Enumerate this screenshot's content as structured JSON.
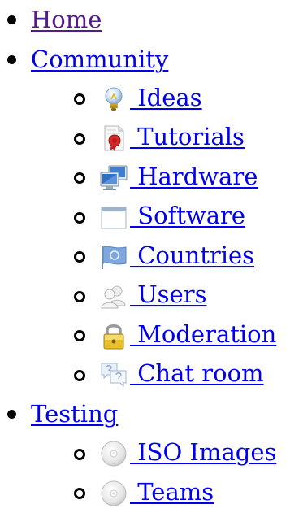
{
  "nav": {
    "items": [
      {
        "label": "Home"
      },
      {
        "label": "Community"
      },
      {
        "label": "Testing"
      }
    ],
    "community_children": [
      {
        "label": " Ideas",
        "icon": "lightbulb-icon"
      },
      {
        "label": " Tutorials",
        "icon": "document-seal-icon"
      },
      {
        "label": " Hardware",
        "icon": "computers-icon"
      },
      {
        "label": " Software",
        "icon": "window-icon"
      },
      {
        "label": " Countries",
        "icon": "flag-icon"
      },
      {
        "label": " Users",
        "icon": "users-icon"
      },
      {
        "label": " Moderation",
        "icon": "padlock-icon"
      },
      {
        "label": " Chat room",
        "icon": "speech-bubbles-icon"
      }
    ],
    "testing_children": [
      {
        "label": " ISO Images",
        "icon": "disc-icon"
      },
      {
        "label": " Teams",
        "icon": "disc-icon"
      }
    ]
  },
  "colors": {
    "link": "#0000ee",
    "visited_link": "#551a8b"
  }
}
